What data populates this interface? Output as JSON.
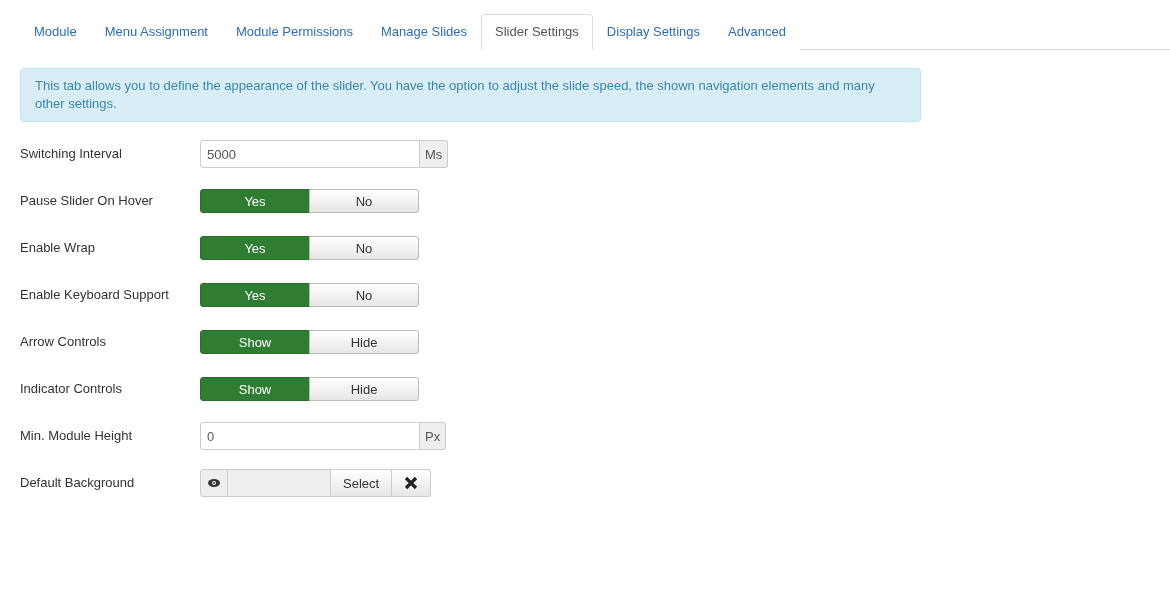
{
  "tabs": [
    {
      "label": "Module",
      "selected": false
    },
    {
      "label": "Menu Assignment",
      "selected": false
    },
    {
      "label": "Module Permissions",
      "selected": false
    },
    {
      "label": "Manage Slides",
      "selected": false
    },
    {
      "label": "Slider Settings",
      "selected": true
    },
    {
      "label": "Display Settings",
      "selected": false
    },
    {
      "label": "Advanced",
      "selected": false
    }
  ],
  "info": "This tab allows you to define the appearance of the slider. You have the option to adjust the slide speed, the shown navigation elements and many other settings.",
  "fields": [
    {
      "kind": "text",
      "label": "Switching Interval",
      "value": "5000",
      "unit": "Ms"
    },
    {
      "kind": "toggle",
      "label": "Pause Slider On Hover",
      "options": [
        {
          "label": "Yes",
          "selected": true
        },
        {
          "label": "No",
          "selected": false
        }
      ]
    },
    {
      "kind": "toggle",
      "label": "Enable Wrap",
      "options": [
        {
          "label": "Yes",
          "selected": true
        },
        {
          "label": "No",
          "selected": false
        }
      ]
    },
    {
      "kind": "toggle",
      "label": "Enable Keyboard Support",
      "options": [
        {
          "label": "Yes",
          "selected": true
        },
        {
          "label": "No",
          "selected": false
        }
      ]
    },
    {
      "kind": "toggle",
      "label": "Arrow Controls",
      "options": [
        {
          "label": "Show",
          "selected": true
        },
        {
          "label": "Hide",
          "selected": false
        }
      ]
    },
    {
      "kind": "toggle",
      "label": "Indicator Controls",
      "options": [
        {
          "label": "Show",
          "selected": true
        },
        {
          "label": "Hide",
          "selected": false
        }
      ]
    },
    {
      "kind": "text",
      "label": "Min. Module Height",
      "value": "0",
      "unit": "Px"
    },
    {
      "kind": "media",
      "label": "Default Background",
      "button": "Select"
    }
  ]
}
